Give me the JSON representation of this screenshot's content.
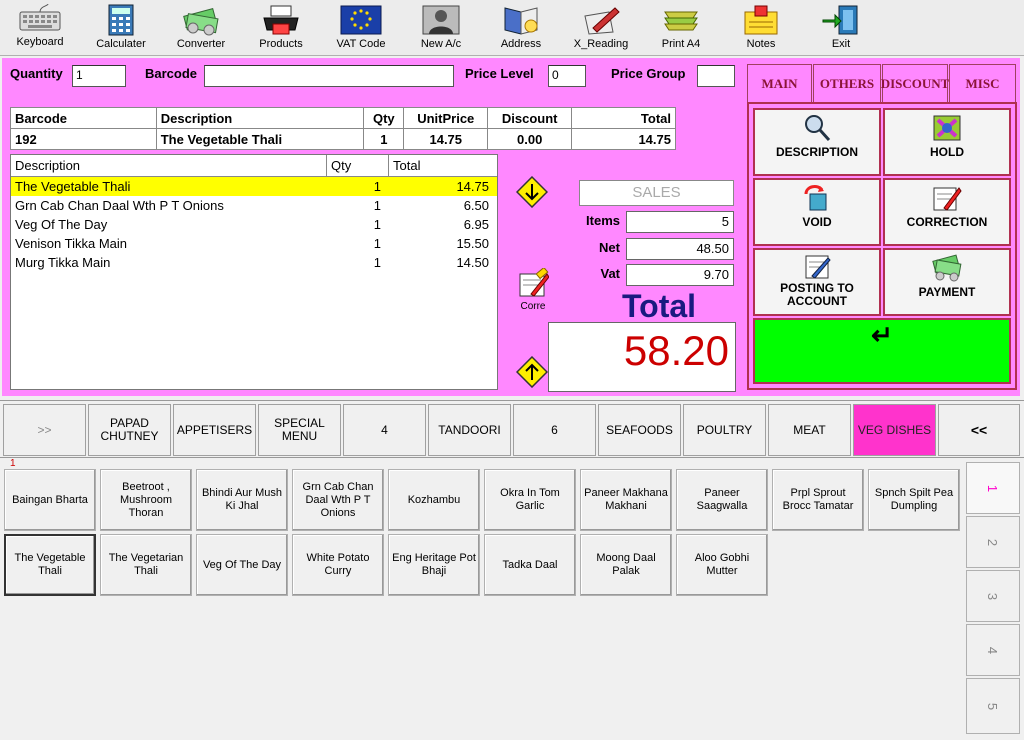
{
  "toolbar": [
    {
      "label": "Keyboard",
      "icon": "keyboard-icon"
    },
    {
      "label": "Calculater",
      "icon": "calculator-icon"
    },
    {
      "label": "Converter",
      "icon": "money-icon"
    },
    {
      "label": "Products",
      "icon": "printer-icon"
    },
    {
      "label": "VAT Code",
      "icon": "eu-flag-icon"
    },
    {
      "label": "New A/c",
      "icon": "person-icon"
    },
    {
      "label": "Address",
      "icon": "address-book-icon"
    },
    {
      "label": "X_Reading",
      "icon": "pen-icon"
    },
    {
      "label": "Print A4",
      "icon": "stack-icon"
    },
    {
      "label": "Notes",
      "icon": "notes-icon"
    },
    {
      "label": "Exit",
      "icon": "exit-icon"
    }
  ],
  "form": {
    "quantity_label": "Quantity",
    "quantity_value": "1",
    "barcode_label": "Barcode",
    "barcode_value": "",
    "price_level_label": "Price Level",
    "price_level_value": "0",
    "price_group_label": "Price Group",
    "price_group_value": ""
  },
  "barcode_table": {
    "headers": [
      "Barcode",
      "Description",
      "Qty",
      "UnitPrice",
      "Discount",
      "Total"
    ],
    "row": [
      "192",
      "The Vegetable Thali",
      "1",
      "14.75",
      "0.00",
      "14.75"
    ]
  },
  "items": {
    "headers": [
      "Description",
      "Qty",
      "Total"
    ],
    "rows": [
      {
        "desc": "The Vegetable Thali",
        "qty": "1",
        "total": "14.75"
      },
      {
        "desc": "Grn Cab Chan Daal Wth P T Onions",
        "qty": "1",
        "total": "6.50"
      },
      {
        "desc": "Veg Of The Day",
        "qty": "1",
        "total": "6.95"
      },
      {
        "desc": "Venison Tikka Main",
        "qty": "1",
        "total": "15.50"
      },
      {
        "desc": "Murg Tikka Main",
        "qty": "1",
        "total": "14.50"
      }
    ]
  },
  "corre_label": "Corre",
  "totals": {
    "mode": "SALES",
    "items_label": "Items",
    "items_value": "5",
    "net_label": "Net",
    "net_value": "48.50",
    "vat_label": "Vat",
    "vat_value": "9.70",
    "total_label": "Total",
    "total_value": "58.20"
  },
  "right_tabs": [
    "MAIN",
    "OTHERS",
    "DISCOUNT",
    "MISC"
  ],
  "functions": [
    {
      "label": "DESCRIPTION",
      "icon": "magnifier-icon"
    },
    {
      "label": "HOLD",
      "icon": "hold-icon"
    },
    {
      "label": "VOID",
      "icon": "void-icon"
    },
    {
      "label": "CORRECTION",
      "icon": "correction-icon"
    },
    {
      "label": "POSTING TO ACCOUNT",
      "icon": "posting-icon"
    },
    {
      "label": "PAYMENT",
      "icon": "payment-icon"
    }
  ],
  "enter_symbol": "↵",
  "categories": [
    ">>",
    "PAPAD CHUTNEY",
    "APPETISERS",
    "SPECIAL MENU",
    "4",
    "TANDOORI",
    "6",
    "SEAFOODS",
    "POULTRY",
    "MEAT",
    "VEG DISHES",
    "<<"
  ],
  "grid_marker": "1",
  "grid_items": [
    "Baingan Bharta",
    "Beetroot , Mushroom Thoran",
    "Bhindi Aur Mush Ki Jhal",
    "Grn Cab Chan Daal Wth P T Onions",
    "Kozhambu",
    "Okra In Tom Garlic",
    "Paneer Makhana Makhani",
    "Paneer Saagwalla",
    "Prpl Sprout Brocc Tamatar",
    "Spnch Spilt Pea Dumpling",
    "The Vegetable Thali",
    "The Vegetarian Thali",
    "Veg Of The Day",
    "White Potato Curry",
    "Eng Heritage Pot Bhaji",
    "Tadka Daal",
    "Moong Daal Palak",
    "Aloo Gobhi Mutter"
  ],
  "pages": [
    "1",
    "2",
    "3",
    "4",
    "5"
  ],
  "colors": {
    "panel_pink": "#ff88ff",
    "selected_row": "#ffff00",
    "total_red": "#cc0000",
    "total_label_blue": "#1a1a80",
    "enter_green": "#00ff00",
    "active_category": "#ff33cc"
  }
}
